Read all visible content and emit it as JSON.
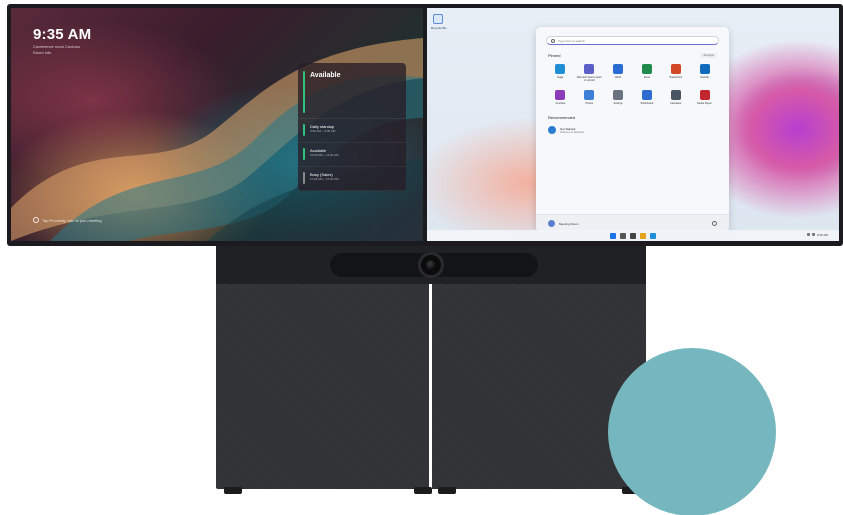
{
  "left_screen": {
    "time": "9:35 AM",
    "subtitle_line1": "Conference room Contoso",
    "subtitle_line2": "Room info",
    "status_card": {
      "title": "Available",
      "slots": [
        {
          "title": "Daily standup",
          "time": "9:00 AM – 9:30 AM",
          "state": "available"
        },
        {
          "title": "Available",
          "time": "10:00 AM – 11:00 AM",
          "state": "available"
        },
        {
          "title": "Busy (Sales)",
          "time": "11:00 AM – 12:00 PM",
          "state": "busy"
        }
      ]
    },
    "proximity_text": "Tap Proximity Join to join meeting"
  },
  "right_screen": {
    "desktop_icon_label": "Recycle Bin",
    "start_menu": {
      "search_placeholder": "Type here to search",
      "pinned_label": "Pinned",
      "all_apps_label": "All apps",
      "apps": [
        {
          "label": "Edge",
          "color": "#1f8fd6"
        },
        {
          "label": "Microsoft Teams (work or school)",
          "color": "#5b5fc7"
        },
        {
          "label": "Word",
          "color": "#2b6cd3"
        },
        {
          "label": "Excel",
          "color": "#1e8a4c"
        },
        {
          "label": "PowerPoint",
          "color": "#d24726"
        },
        {
          "label": "Outlook",
          "color": "#0f6cbd"
        },
        {
          "label": "OneNote",
          "color": "#8b3ab8"
        },
        {
          "label": "Photos",
          "color": "#3d7fd6"
        },
        {
          "label": "Settings",
          "color": "#6b7380"
        },
        {
          "label": "Whiteboard",
          "color": "#2e6cd1"
        },
        {
          "label": "Calculator",
          "color": "#4a5563"
        },
        {
          "label": "Media Player",
          "color": "#c2262e"
        }
      ],
      "recommended_label": "Recommended",
      "recommended_item": {
        "title": "Get Started",
        "subtitle": "Welcome to Windows"
      },
      "user_name": "Meeting Room"
    },
    "taskbar_clock": "9:35 AM"
  },
  "colors": {
    "available": "#2ec27e",
    "busy": "#8a8a8a",
    "teal_circle": "#76b7bf",
    "stand": "#313235"
  }
}
